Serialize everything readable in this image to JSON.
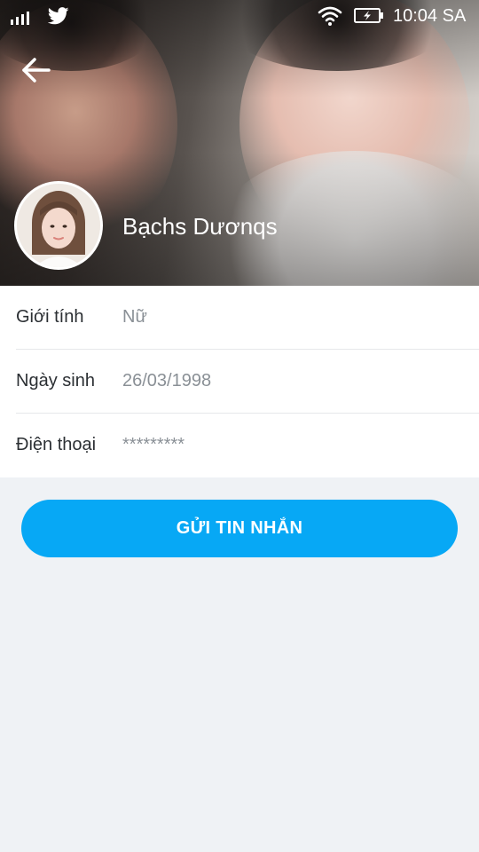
{
  "status_bar": {
    "time": "10:04 SA",
    "icons": [
      "signal-icon",
      "twitter-icon",
      "wifi-icon",
      "battery-charging-icon"
    ]
  },
  "header": {
    "back_icon": "arrow-left-icon",
    "avatar": "avatar",
    "name": "Bạchs Dươnqs"
  },
  "info": {
    "rows": [
      {
        "label": "Giới tính",
        "value": "Nữ"
      },
      {
        "label": "Ngày sinh",
        "value": "26/03/1998"
      },
      {
        "label": "Điện thoại",
        "value": "*********"
      }
    ]
  },
  "actions": {
    "send_message_label": "GỬI TIN NHẮN"
  },
  "colors": {
    "accent": "#07a8f5",
    "background": "#eff2f5",
    "card": "#ffffff",
    "label_text": "#2b2f33",
    "value_text": "#8a9096"
  }
}
